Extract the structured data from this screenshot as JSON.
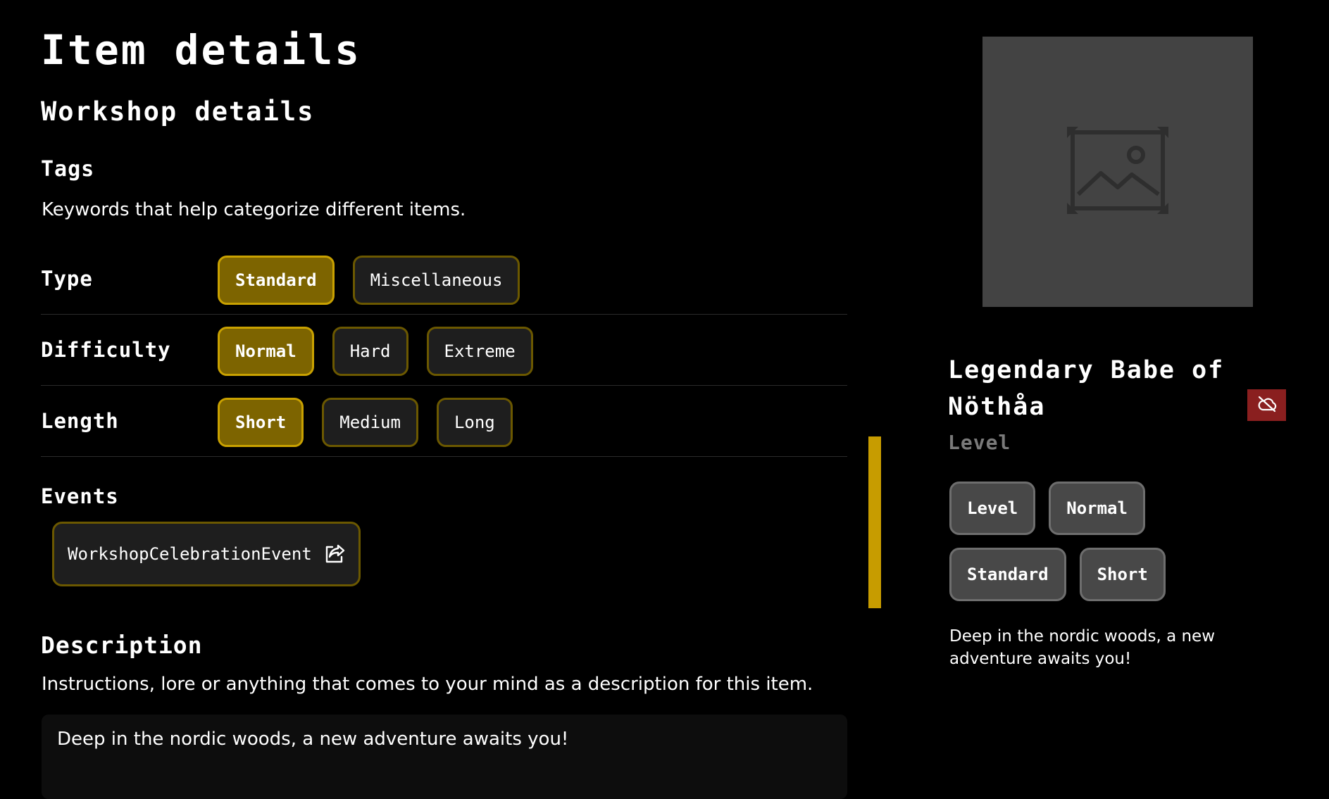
{
  "page": {
    "title": "Item details",
    "section_title": "Workshop details"
  },
  "tags": {
    "heading": "Tags",
    "description": "Keywords that help categorize different items.",
    "rows": [
      {
        "label": "Type",
        "options": [
          "Standard",
          "Miscellaneous"
        ],
        "selected": "Standard"
      },
      {
        "label": "Difficulty",
        "options": [
          "Normal",
          "Hard",
          "Extreme"
        ],
        "selected": "Normal"
      },
      {
        "label": "Length",
        "options": [
          "Short",
          "Medium",
          "Long"
        ],
        "selected": "Short"
      }
    ]
  },
  "events": {
    "heading": "Events",
    "items": [
      {
        "label": "WorkshopCelebrationEvent",
        "icon": "share-icon"
      }
    ]
  },
  "description": {
    "heading": "Description",
    "hint": "Instructions, lore or anything that comes to your mind as a description for this item.",
    "value": "Deep in the nordic woods, a new adventure awaits you!"
  },
  "preview": {
    "thumbnail_icon": "image-placeholder-icon",
    "name": "Legendary Babe of Nöthåa",
    "kind": "Level",
    "visibility_icon": "cloud-off-icon",
    "tags": [
      "Level",
      "Normal",
      "Standard",
      "Short"
    ],
    "description": "Deep in the nordic woods, a new adventure awaits you!"
  },
  "colors": {
    "accent": "#c79c00",
    "chip_active_bg": "#7d6400",
    "danger": "#8a1f1f"
  }
}
